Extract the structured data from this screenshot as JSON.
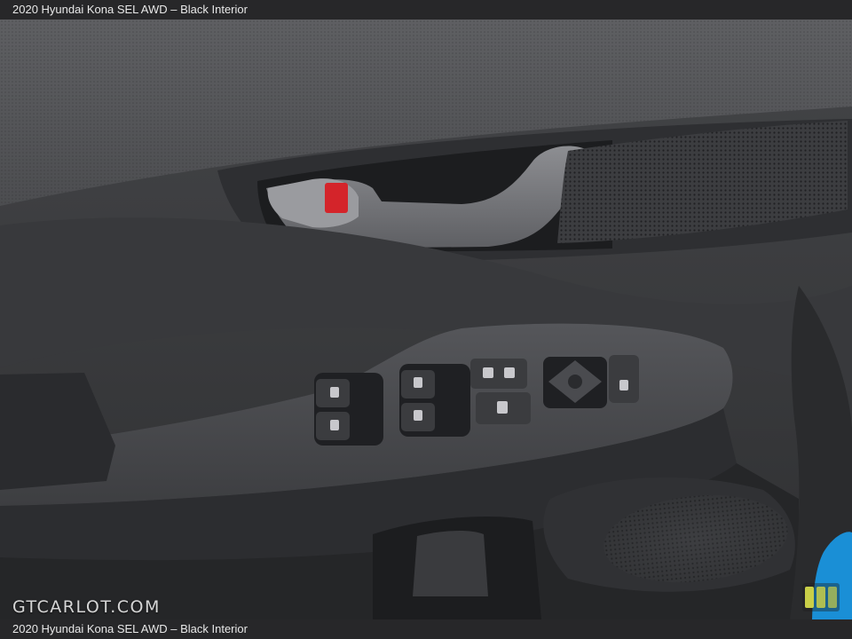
{
  "caption": {
    "top_text": "2020 Hyundai Kona SEL AWD – Black Interior",
    "bottom_text": "2020 Hyundai Kona SEL AWD – Black Interior"
  },
  "watermark": {
    "text": "GTCARLOT.COM"
  },
  "photo_subject": {
    "colors": {
      "door_panel": "#3a3b3d",
      "trim_upper": "#5a5b5d",
      "lock_button": "#d4242a",
      "body_paint": "#1a8fd6"
    }
  }
}
